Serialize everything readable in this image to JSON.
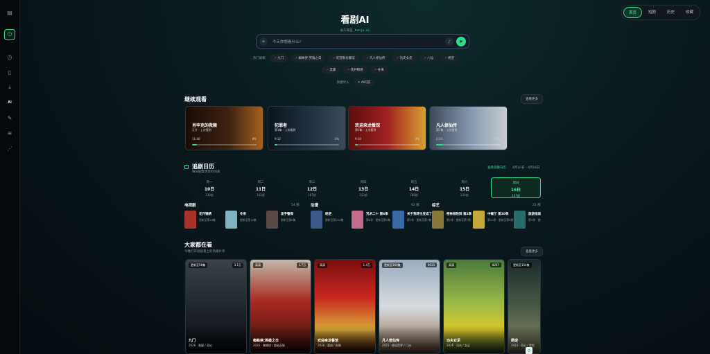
{
  "sidebar": {
    "icons": [
      "sidebar-toggle-icon",
      "power-icon",
      "history-icon",
      "bookmark-icon",
      "download-icon",
      "ai-icon",
      "brush-icon",
      "filter-icon",
      "share-icon"
    ],
    "ai_label": "AI"
  },
  "topnav": {
    "items": [
      "首页",
      "短剧",
      "历史",
      "收藏"
    ]
  },
  "header": {
    "title": "看剧AI",
    "subtitle": "永久域名",
    "url": "kanju.ai"
  },
  "search": {
    "placeholder": "今天你想看什么?"
  },
  "hot": {
    "label": "热门剧集",
    "row1": [
      "九门",
      "蜘蛛侠:英雄之日",
      "欢迎来龙餐馆",
      "凡人修仙传",
      "功夫女足",
      "八仙"
    ],
    "row1_extra": "杨逆",
    "row2": [
      "度藤",
      "花开锦绣",
      "冬来"
    ]
  },
  "quick": {
    "label": "快捷导入",
    "chip": "AI问答"
  },
  "continue": {
    "title": "继续观看",
    "more": "查看更多",
    "items": [
      {
        "title": "肖申克的救赎",
        "sub": "正片 · 上次看到",
        "time": "11:40",
        "pct": "8%",
        "progress": 0.08
      },
      {
        "title": "犯罪者",
        "sub": "第1集 · 上次看到",
        "time": "9:12",
        "pct": "1%",
        "progress": 0.01
      },
      {
        "title": "欢迎来龙餐馆",
        "sub": "第5集 · 上次看到",
        "time": "9:10",
        "pct": "4%",
        "progress": 0.04
      },
      {
        "title": "凡人修仙传",
        "sub": "第1集 · 上次看到",
        "time": "2:14",
        "pct": "11%",
        "progress": 0.11
      }
    ]
  },
  "calendar": {
    "title": "追剧日历",
    "sub": "每日剧集更新时间表",
    "link": "查看完整日历",
    "range": "4月10日 - 4月16日",
    "days": [
      {
        "w": "周一",
        "d": "10日",
        "c": "130部"
      },
      {
        "w": "周二",
        "d": "11日",
        "c": "142部"
      },
      {
        "w": "周三",
        "d": "12日",
        "c": "167部"
      },
      {
        "w": "周四",
        "d": "13日",
        "c": "152部"
      },
      {
        "w": "周五",
        "d": "14日",
        "c": "188部"
      },
      {
        "w": "周六",
        "d": "15日",
        "c": "234部"
      },
      {
        "w": "周日",
        "d": "16日",
        "c": "167部"
      }
    ],
    "categories": [
      {
        "name": "电视剧",
        "count": "54 部",
        "items": [
          {
            "n": "花开锦绣",
            "e": "更新至第18集",
            "c": "#a8322c"
          },
          {
            "n": "冬来",
            "e": "更新至第16集",
            "c": "#7fb3c2"
          },
          {
            "n": "圣手警探",
            "e": "更新至第6集",
            "c": "#5a4a48"
          }
        ]
      },
      {
        "name": "动漫",
        "count": "92 部",
        "items": [
          {
            "n": "杨逆",
            "e": "更新至第154集",
            "c": "#3a5a8a"
          },
          {
            "n": "咒术二十 第6季",
            "e": "第6季 · 更新至第5集",
            "c": "#c46a8a"
          },
          {
            "n": "关于我转生变成了史莱姆",
            "e": "第3季 · 更新至第7集",
            "c": "#3a6aa4"
          }
        ]
      },
      {
        "name": "综艺",
        "count": "21 部",
        "items": [
          {
            "n": "密林探险拜 第2季",
            "e": "第2季 · 更新至第7期",
            "c": "#8a7a3a"
          },
          {
            "n": "中餐厅 第10季",
            "e": "第10季 · 更新至第6期下",
            "c": "#c4a83a"
          },
          {
            "n": "旅游指南",
            "e": "第3季 · 更新至第3期",
            "c": "#2a6a6a"
          }
        ]
      }
    ]
  },
  "popular": {
    "title": "大家都在看",
    "sub": "今晚打开就能看上的热播片单",
    "more": "查看更多",
    "items": [
      {
        "tag": "更新至58集",
        "count": "3.1万",
        "title": "九门",
        "meta": "2026 · 悬疑 / 奇幻"
      },
      {
        "tag": "高清",
        "count": "1.7万",
        "title": "蜘蛛侠:英雄之日",
        "meta": "2026 · 蜘蛛侠 / 超级英雄"
      },
      {
        "tag": "高清",
        "count": "1.4万",
        "title": "欢迎来龙餐馆",
        "meta": "2026 · 喜剧 / 剧情"
      },
      {
        "tag": "更新至160集",
        "count": "6615",
        "title": "凡人修仙传",
        "meta": "2025 · 修仙世界 / 门派"
      },
      {
        "tag": "高清",
        "count": "8267",
        "title": "功夫女足",
        "meta": "2026 · 功夫 / 女足"
      },
      {
        "tag": "更新至154集",
        "count": "",
        "title": "杨逆",
        "meta": "2023 · 奇幻 / 冒险"
      }
    ]
  }
}
